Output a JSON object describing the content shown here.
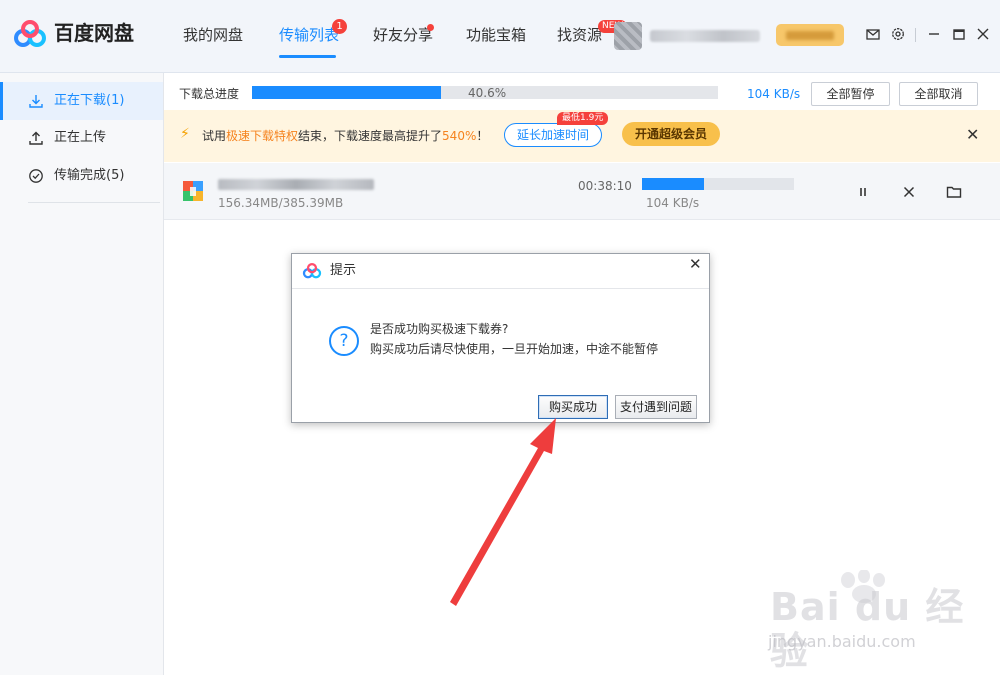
{
  "app": {
    "name": "百度网盘"
  },
  "nav": {
    "items": [
      {
        "label": "我的网盘"
      },
      {
        "label": "传输列表",
        "badge": "1",
        "active": true
      },
      {
        "label": "好友分享",
        "dot": true
      },
      {
        "label": "功能宝箱"
      },
      {
        "label": "找资源",
        "badge": "NEW"
      }
    ]
  },
  "window_controls": [
    "mail-icon",
    "gear-icon",
    "minimize-icon",
    "maximize-icon",
    "close-icon"
  ],
  "sidebar": {
    "items": [
      {
        "label": "正在下载(1)",
        "icon": "download-icon",
        "active": true
      },
      {
        "label": "正在上传",
        "icon": "upload-icon"
      },
      {
        "label": "传输完成(5)",
        "icon": "check-circle-icon"
      }
    ]
  },
  "progress": {
    "label": "下载总进度",
    "percent_text": "40.6%",
    "percent": 40.6,
    "speed": "104 KB/s",
    "pause_all": "全部暂停",
    "cancel_all": "全部取消"
  },
  "notice": {
    "text_prefix": "试用",
    "text_highlight1": "极速下载特权",
    "text_middle": "结束，下载速度最高提升了",
    "text_highlight2": "540%",
    "text_suffix": "！",
    "extend_label": "延长加速时间",
    "extend_tag": "最低1.9元",
    "vip_label": "开通超级会员"
  },
  "download": {
    "size": "156.34MB/385.39MB",
    "time_left": "00:38:10",
    "progress": 0.406,
    "speed": "104 KB/s"
  },
  "dialog": {
    "title": "提示",
    "line1": "是否成功购买极速下载券?",
    "line2": "购买成功后请尽快使用，一旦开始加速，中途不能暂停",
    "confirm": "购买成功",
    "problem": "支付遇到问题"
  },
  "watermark": {
    "text": "Bai du 经验",
    "sub": "jingyan.baidu.com"
  },
  "colors": {
    "accent": "#1a8cff",
    "danger": "#f5413b",
    "notice_bg": "#fff5e0",
    "vip": "#f8c04b",
    "arrow": "#ee3d3d"
  }
}
